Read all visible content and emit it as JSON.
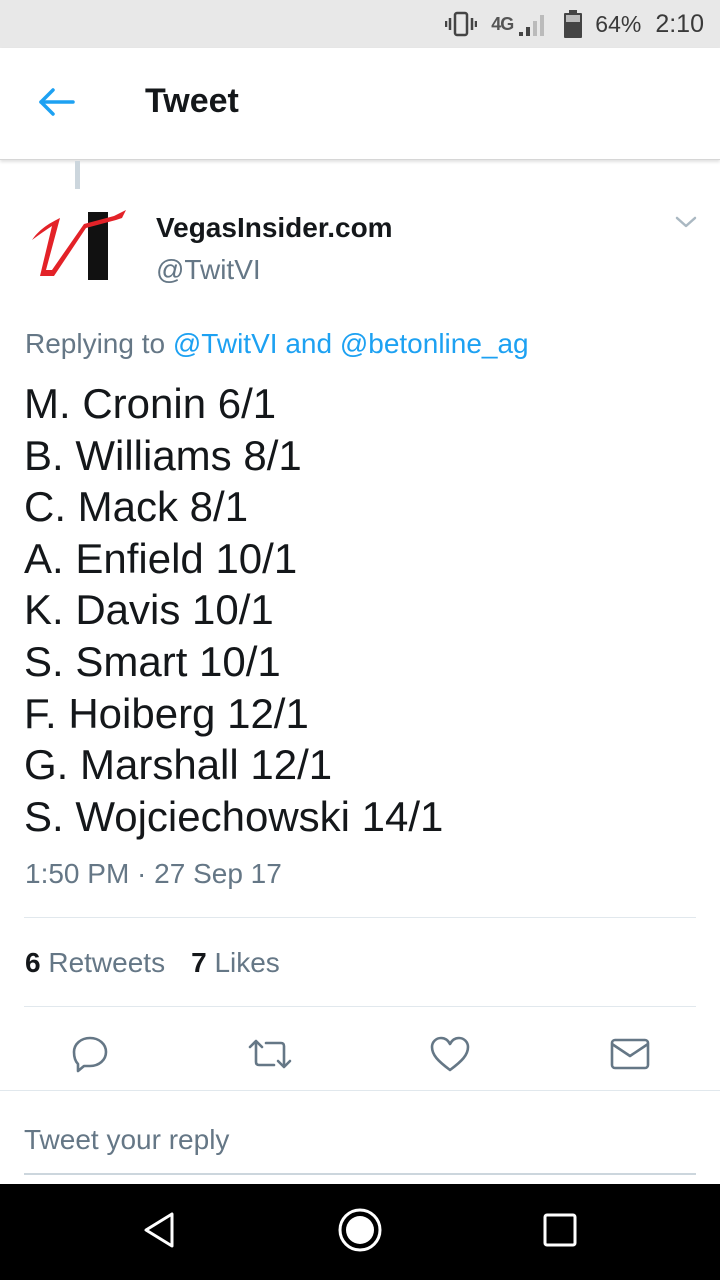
{
  "status_bar": {
    "network": "4G",
    "battery_percent": "64%",
    "time": "2:10"
  },
  "header": {
    "title": "Tweet",
    "back_icon": "arrow-left-icon"
  },
  "tweet": {
    "author_name": "VegasInsider.com",
    "author_handle": "@TwitVI",
    "replying_prefix": "Replying to",
    "replying_mention_1": "@TwitVI",
    "replying_and": "and",
    "replying_mention_2": "@betonline_ag",
    "lines": [
      "M. Cronin 6/1",
      "B. Williams 8/1",
      "C. Mack 8/1",
      "A. Enfield 10/1",
      "K. Davis 10/1",
      "S. Smart 10/1",
      "F. Hoiberg 12/1",
      "G. Marshall 12/1",
      "S. Wojciechowski 14/1"
    ],
    "timestamp": "1:50 PM · 27 Sep 17",
    "retweets_count": "6",
    "retweets_label": "Retweets",
    "likes_count": "7",
    "likes_label": "Likes"
  },
  "actions": [
    "reply-icon",
    "retweet-icon",
    "heart-icon",
    "mail-icon"
  ],
  "reply_box": {
    "placeholder": "Tweet your reply"
  },
  "colors": {
    "accent": "#1da1f2",
    "muted": "#657786",
    "text": "#14171a"
  }
}
